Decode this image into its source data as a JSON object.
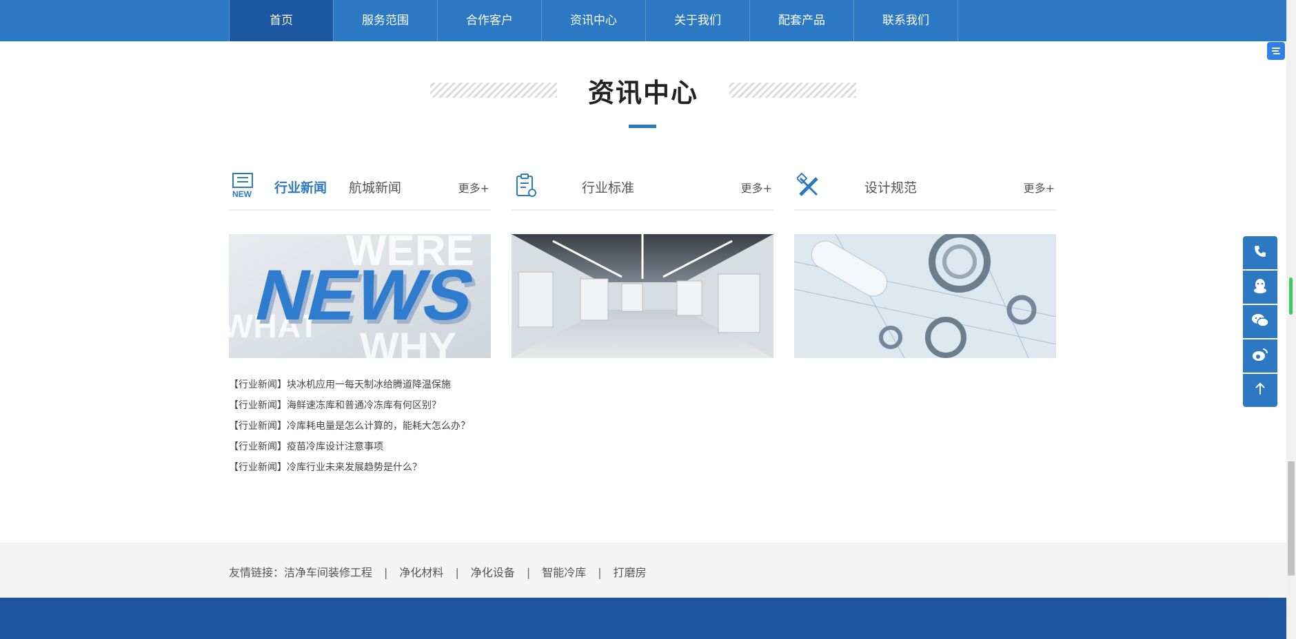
{
  "nav": {
    "items": [
      "首页",
      "服务范围",
      "合作客户",
      "资讯中心",
      "关于我们",
      "配套产品",
      "联系我们"
    ],
    "active": "首页"
  },
  "section": {
    "title": "资讯中心"
  },
  "columns": [
    {
      "icon": "news-icon",
      "tabs": [
        "行业新闻",
        "航城新闻"
      ],
      "active_tab": "行业新闻",
      "more": "更多+",
      "image": "news-3d-text-image",
      "list": [
        "【行业新闻】块冰机应用一每天制冰给腾道降温保施",
        "【行业新闻】海鲜速冻库和普通冷冻库有何区别？",
        "【行业新闻】冷库耗电量是怎么计算的，能耗大怎么办？",
        "【行业新闻】疫苗冷库设计注意事项",
        "【行业新闻】冷库行业未来发展趋势是什么？"
      ]
    },
    {
      "icon": "clipboard-icon",
      "title": "行业标准",
      "more": "更多+",
      "image": "cleanroom-hall-image"
    },
    {
      "icon": "design-tools-icon",
      "title": "设计规范",
      "more": "更多+",
      "image": "bearings-blueprint-image"
    }
  ],
  "links": {
    "label": "友情链接：",
    "items": [
      "洁净车间装修工程",
      "净化材料",
      "净化设备",
      "智能冷库",
      "打磨房"
    ],
    "separator": "|"
  },
  "sidebar": [
    "phone-icon",
    "qq-icon",
    "wechat-icon",
    "weibo-icon",
    "arrow-up-icon"
  ],
  "colors": {
    "primary": "#2c78c3",
    "nav_active": "#1d56a0",
    "footer": "#1d55a0"
  }
}
